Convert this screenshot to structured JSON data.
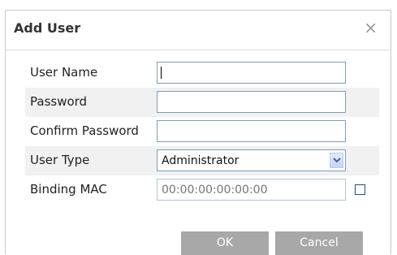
{
  "dialog": {
    "title": "Add User",
    "close_icon": "close-icon",
    "close_glyph": "×"
  },
  "form": {
    "user_name": {
      "label": "User Name",
      "value": ""
    },
    "password": {
      "label": "Password",
      "value": ""
    },
    "confirm_password": {
      "label": "Confirm Password",
      "value": ""
    },
    "user_type": {
      "label": "User Type",
      "value": "Administrator"
    },
    "binding_mac": {
      "label": "Binding MAC",
      "value": "",
      "placeholder": "00:00:00:00:00:00",
      "checked": false
    }
  },
  "buttons": {
    "ok": "OK",
    "cancel": "Cancel"
  },
  "colors": {
    "button_bg": "#a8a8a8",
    "shaded_row": "#f1f1f1",
    "field_border": "#7f9db9"
  }
}
